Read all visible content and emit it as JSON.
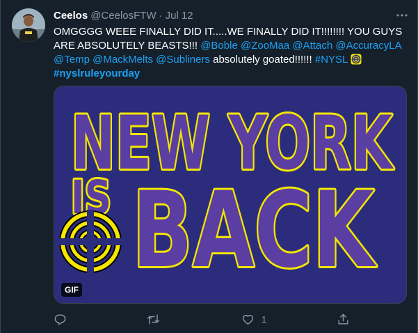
{
  "tweet": {
    "display_name": "Ceelos",
    "handle": "@CeelosFTW",
    "separator": "·",
    "date": "Jul 12",
    "text": {
      "part1": "OMGGGG WEEE FINALLY DID IT.....WE FINALLY DID IT!!!!!!!! YOU GUYS ARE ABSOLUTELY BEASTS!!! ",
      "mention1": "@Boble",
      "mention2": "@ZooMaa",
      "mention3": "@Attach",
      "mention4": "@AccuracyLA",
      "mention5": "@Temp",
      "mention6": "@MackMelts",
      "mention7": "@Subliners",
      "part2": " absolutely goated!!!!!! ",
      "hashtag1": "#NYSL",
      "hashtag2": "#nyslruleyourday"
    },
    "media": {
      "line1": "NEW YORK",
      "line2": "IS",
      "line3": "BACK",
      "badge": "GIF",
      "bg_color": "#2b2d7c",
      "text_color": "#5b3ea1",
      "outline_color": "#f5e600"
    },
    "actions": {
      "reply_icon": "reply-icon",
      "retweet_icon": "retweet-icon",
      "like_icon": "heart-icon",
      "like_count": "1",
      "share_icon": "share-icon"
    },
    "colors": {
      "background": "#15202b",
      "link": "#1da1f2",
      "secondary_text": "#8899a6"
    }
  }
}
